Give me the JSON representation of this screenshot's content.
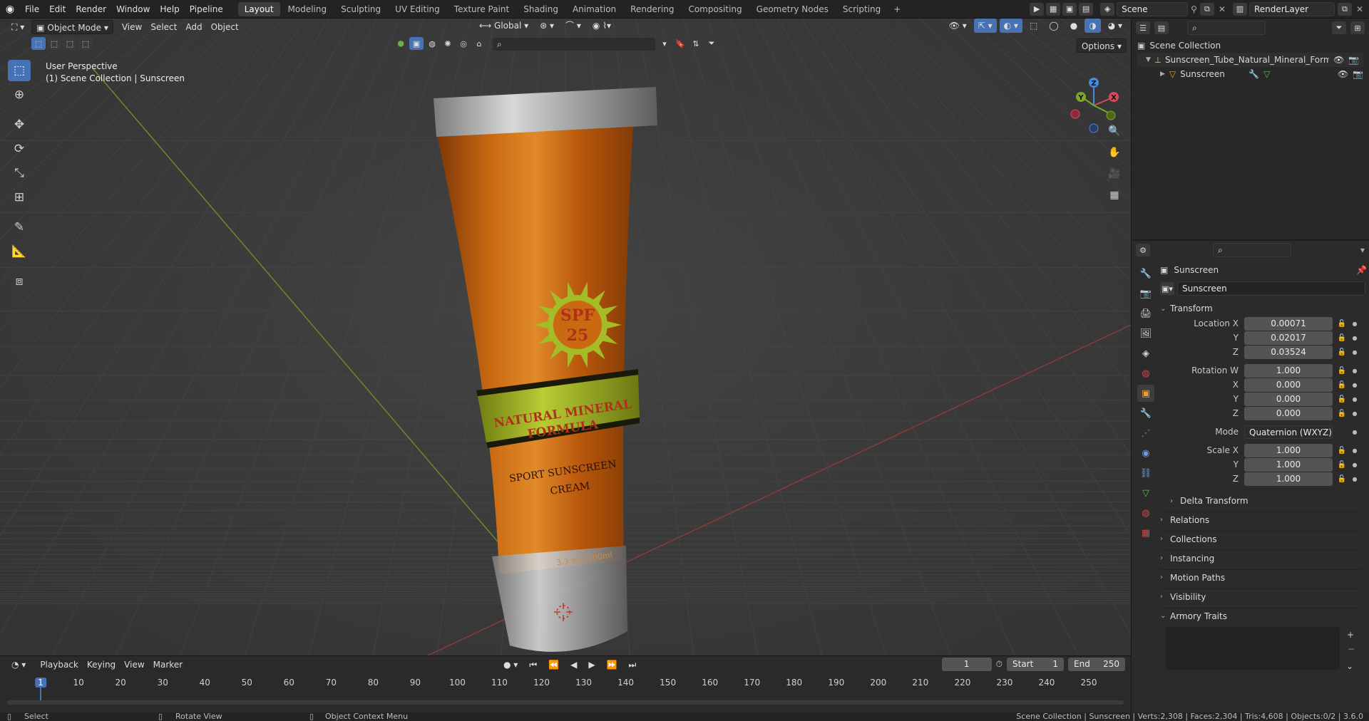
{
  "topbar": {
    "menus": [
      "File",
      "Edit",
      "Render",
      "Window",
      "Help",
      "Pipeline"
    ],
    "workspaces": [
      "Layout",
      "Modeling",
      "Sculpting",
      "UV Editing",
      "Texture Paint",
      "Shading",
      "Animation",
      "Rendering",
      "Compositing",
      "Geometry Nodes",
      "Scripting"
    ],
    "active_workspace": "Layout",
    "add_tab": "+",
    "scene_name": "Scene",
    "render_layer": "RenderLayer"
  },
  "viewport_header": {
    "mode": "Object Mode",
    "menus": [
      "View",
      "Select",
      "Add",
      "Object"
    ],
    "orientation": "Global",
    "options": "Options"
  },
  "viewport": {
    "perspective": "User Perspective",
    "collection_path": "(1) Scene Collection | Sunscreen",
    "gizmo_axes": {
      "z": "Z",
      "y": "Y",
      "x": "X"
    },
    "product": {
      "spf": "SPF",
      "spf_value": "25",
      "line1": "NATURAL MINERAL",
      "line2": "FORMULA",
      "line3": "SPORT SUNSCREEN",
      "line4": "CREAM",
      "size": "3.3 oz / 100ml"
    }
  },
  "outliner": {
    "root": "Scene Collection",
    "collection": "Sunscreen_Tube_Natural_Mineral_Formi",
    "object": "Sunscreen"
  },
  "properties": {
    "object_name": "Sunscreen",
    "data_name": "Sunscreen",
    "transform_label": "Transform",
    "location": {
      "label": "Location X",
      "x": "0.00071",
      "y": "0.02017",
      "z": "0.03524"
    },
    "rotation": {
      "label": "Rotation W",
      "w": "1.000",
      "x": "0.000",
      "y": "0.000",
      "z": "0.000"
    },
    "mode_label": "Mode",
    "mode_value": "Quaternion (WXYZ)",
    "scale": {
      "label": "Scale X",
      "x": "1.000",
      "y": "1.000",
      "z": "1.000"
    },
    "axis_labels": {
      "x": "X",
      "y": "Y",
      "z": "Z"
    },
    "panels": [
      "Delta Transform",
      "Relations",
      "Collections",
      "Instancing",
      "Motion Paths",
      "Visibility",
      "Armory Traits"
    ]
  },
  "timeline": {
    "menus": [
      "Playback",
      "Keying",
      "View",
      "Marker"
    ],
    "current_frame": "1",
    "start_label": "Start",
    "start": "1",
    "end_label": "End",
    "end": "250",
    "frame_ticks": [
      "1",
      "10",
      "20",
      "30",
      "40",
      "50",
      "60",
      "70",
      "80",
      "90",
      "100",
      "110",
      "120",
      "130",
      "140",
      "150",
      "160",
      "170",
      "180",
      "190",
      "200",
      "210",
      "220",
      "230",
      "240",
      "250"
    ]
  },
  "statusbar": {
    "select": "Select",
    "rotate": "Rotate View",
    "context": "Object Context Menu",
    "stats": "Scene Collection | Sunscreen | Verts:2,308 | Faces:2,304 | Tris:4,608 | Objects:0/2 | 3.6.0"
  },
  "colors": {
    "accent": "#4772b3",
    "tube_orange": "#c9640f",
    "label_green": "#a9c02c",
    "text_red": "#b0301a"
  }
}
